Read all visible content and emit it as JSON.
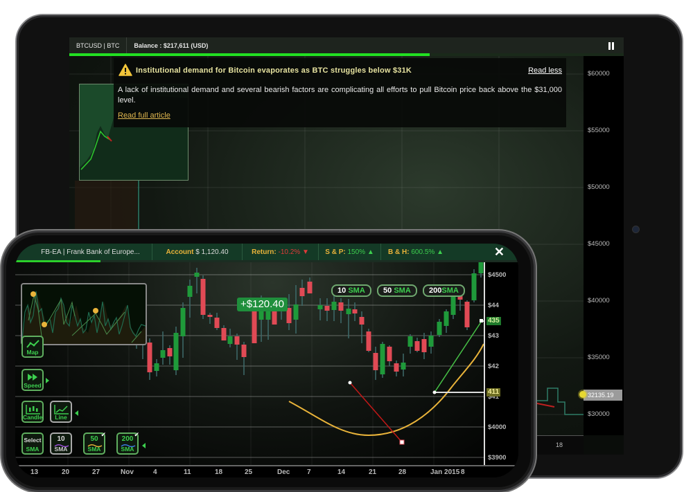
{
  "tablet": {
    "symbol": "BTCUSD | BTC",
    "balance": "Balance : $217,611 (USD)",
    "progress": 0.65,
    "pause_icon": "pause-icon",
    "y_axis_labels": [
      "$60000",
      "$55000",
      "$50000",
      "$45000",
      "$40000",
      "$35000",
      "$30000"
    ],
    "current_price": "32135.19",
    "x_axis_labels": [
      "18"
    ],
    "news": {
      "icon": "warning-icon",
      "title": "Institutional demand for Bitcoin evaporates as BTC struggles below $31K",
      "collapse_label": "Read less",
      "body": "A lack of institutional demand and several bearish factors are complicating all efforts to pull Bitcoin price back above the $31,000 level.",
      "link_label": "Read full article"
    }
  },
  "phone": {
    "symbol": "FB-EA | Frank Bank of Europe...",
    "account_label": "Account",
    "account_value": "$ 1,120.40",
    "return_label": "Return:",
    "return_value": "-10.2%",
    "sp_label": "S & P:",
    "sp_value": "150%",
    "bh_label": "B & H:",
    "bh_value": "600.5%",
    "close_icon": "✕",
    "progress": 0.17,
    "gain": "+$120.40",
    "sma_buttons": [
      {
        "num": "10",
        "label": "SMA"
      },
      {
        "num": "50",
        "label": "SMA"
      },
      {
        "num": "200",
        "label": "SMA"
      }
    ],
    "y_axis_labels": [
      "$4500",
      "$44",
      "$43",
      "$42",
      "$41",
      "$4000",
      "$3900"
    ],
    "price_tags": [
      {
        "text": "435",
        "color": "#1f7a2c"
      },
      {
        "text": "411",
        "color": "#8a8a2c"
      }
    ],
    "x_axis_labels": [
      "13",
      "20",
      "27",
      "Nov",
      "4",
      "11",
      "18",
      "25",
      "Dec",
      "7",
      "14",
      "21",
      "28",
      "Jan 2015",
      "8"
    ],
    "controls": {
      "map": "Map",
      "speed": "Speed",
      "candle": "Candle",
      "line": "Line",
      "select_sma_top": "Select",
      "select_sma_bottom": "SMA",
      "sma10_top": "10",
      "sma10_bottom": "SMA",
      "sma50_top": "50",
      "sma50_bottom": "SMA",
      "sma200_top": "200",
      "sma200_bottom": "SMA",
      "sma10_color": "#9b4fd9",
      "sma50_color": "#e9b33a",
      "sma200_color": "#3d7be0"
    }
  },
  "colors": {
    "up": "#1f9a3a",
    "down": "#e04a55",
    "accent_green": "#2bd02b",
    "gold": "#e9b33a"
  }
}
